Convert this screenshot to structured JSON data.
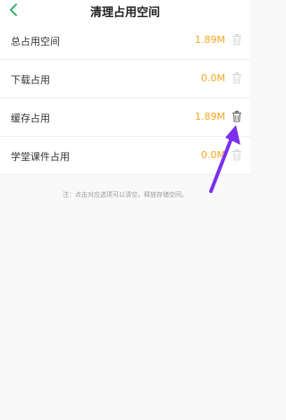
{
  "header": {
    "title": "清理占用空间"
  },
  "rows": [
    {
      "label": "总占用空间",
      "value": "1.89M"
    },
    {
      "label": "下载占用",
      "value": "0.0M"
    },
    {
      "label": "缓存占用",
      "value": "1.89M"
    },
    {
      "label": "学堂课件占用",
      "value": "0.0M"
    }
  ],
  "note": "注：点击对应选项可以清空，释放存储空间。",
  "colors": {
    "accent": "#f5a623",
    "back_arrow": "#3cb371",
    "annotation_arrow": "#7b2ff0",
    "trash_faded": "#d8d8d8",
    "trash_active": "#666666"
  },
  "icons": {
    "back": "chevron-left-icon",
    "trash": "trash-icon",
    "annotation": "arrow-annotation"
  }
}
